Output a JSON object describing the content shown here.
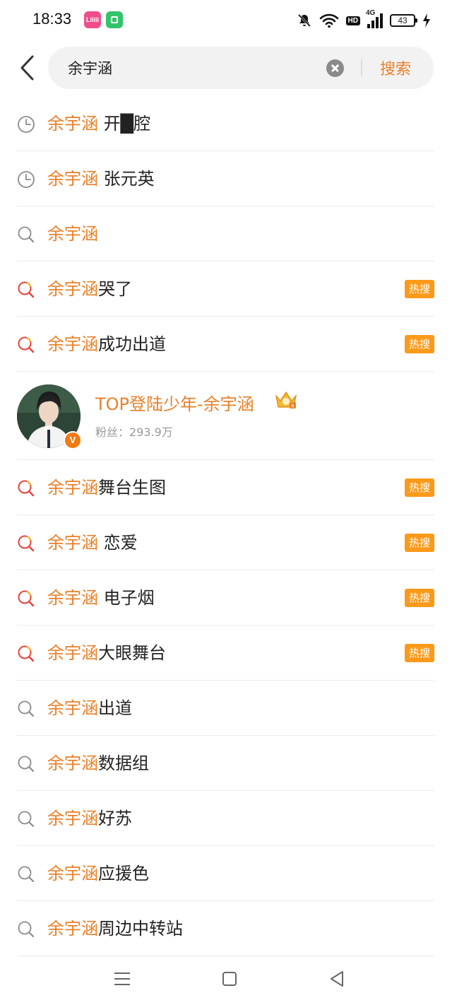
{
  "status_bar": {
    "time": "18:33",
    "app_icon_1": "Lilili",
    "hd_label": "HD",
    "network_label": "4G",
    "battery_level": "43",
    "icons": [
      "mute-bell-icon",
      "wifi-icon",
      "signal-icon",
      "battery-icon",
      "charging-icon"
    ]
  },
  "search": {
    "query": "余宇涵",
    "search_label": "搜索"
  },
  "suggestions": [
    {
      "type": "history",
      "highlight": "余宇涵",
      "rest": " 开█腔",
      "hot": ""
    },
    {
      "type": "history",
      "highlight": "余宇涵",
      "rest": " 张元英",
      "hot": ""
    },
    {
      "type": "search",
      "highlight": "余宇涵",
      "rest": "",
      "hot": ""
    },
    {
      "type": "trending",
      "highlight": "余宇涵",
      "rest": "哭了",
      "hot": "热搜"
    },
    {
      "type": "trending",
      "highlight": "余宇涵",
      "rest": "成功出道",
      "hot": "热搜"
    }
  ],
  "user_card": {
    "name": "TOP登陆少年-余宇涵",
    "followers": "粉丝：293.9万",
    "badge": "V"
  },
  "suggestions_2": [
    {
      "type": "trending",
      "highlight": "余宇涵",
      "rest": "舞台生图",
      "hot": "热搜"
    },
    {
      "type": "trending",
      "highlight": "余宇涵",
      "rest": " 恋爱",
      "hot": "热搜"
    },
    {
      "type": "trending",
      "highlight": "余宇涵",
      "rest": " 电子烟",
      "hot": "热搜"
    },
    {
      "type": "trending",
      "highlight": "余宇涵",
      "rest": "大眼舞台",
      "hot": "热搜"
    },
    {
      "type": "search",
      "highlight": "余宇涵",
      "rest": "出道",
      "hot": ""
    },
    {
      "type": "search",
      "highlight": "余宇涵",
      "rest": "数据组",
      "hot": ""
    },
    {
      "type": "search",
      "highlight": "余宇涵",
      "rest": "好苏",
      "hot": ""
    },
    {
      "type": "search",
      "highlight": "余宇涵",
      "rest": "应援色",
      "hot": ""
    },
    {
      "type": "search",
      "highlight": "余宇涵",
      "rest": "周边中转站",
      "hot": ""
    }
  ],
  "colors": {
    "accent": "#e9812a",
    "hot_badge": "#fb9a1a",
    "trending_icon": "#e8423a"
  }
}
